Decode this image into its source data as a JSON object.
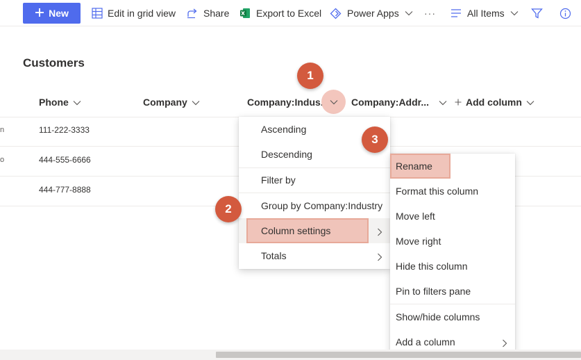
{
  "toolbar": {
    "new_label": "New",
    "edit_grid_label": "Edit in grid view",
    "share_label": "Share",
    "export_label": "Export to Excel",
    "power_apps_label": "Power Apps",
    "more_label": "···",
    "view_label": "All Items"
  },
  "page": {
    "title": "Customers"
  },
  "columns": {
    "phone": "Phone",
    "company": "Company",
    "company_industry": "Company:Indus...",
    "company_address": "Company:Addr...",
    "add_column": "Add column"
  },
  "rows": [
    {
      "edge": "n",
      "phone": "111-222-3333"
    },
    {
      "edge": "o",
      "phone": "444-555-6666"
    },
    {
      "edge": "",
      "phone": "444-777-8888"
    }
  ],
  "column_menu": {
    "items": [
      "Ascending",
      "Descending",
      "Filter by",
      "Group by Company:Industry",
      "Column settings",
      "Totals"
    ]
  },
  "settings_submenu": {
    "items": [
      "Rename",
      "Format this column",
      "Move left",
      "Move right",
      "Hide this column",
      "Pin to filters pane",
      "Show/hide columns",
      "Add a column"
    ]
  },
  "annotations": {
    "step1": "1",
    "step2": "2",
    "step3": "3"
  },
  "colors": {
    "accent": "#4f6bed",
    "highlight": "#f0c4ba",
    "badge": "#d35a3e"
  }
}
